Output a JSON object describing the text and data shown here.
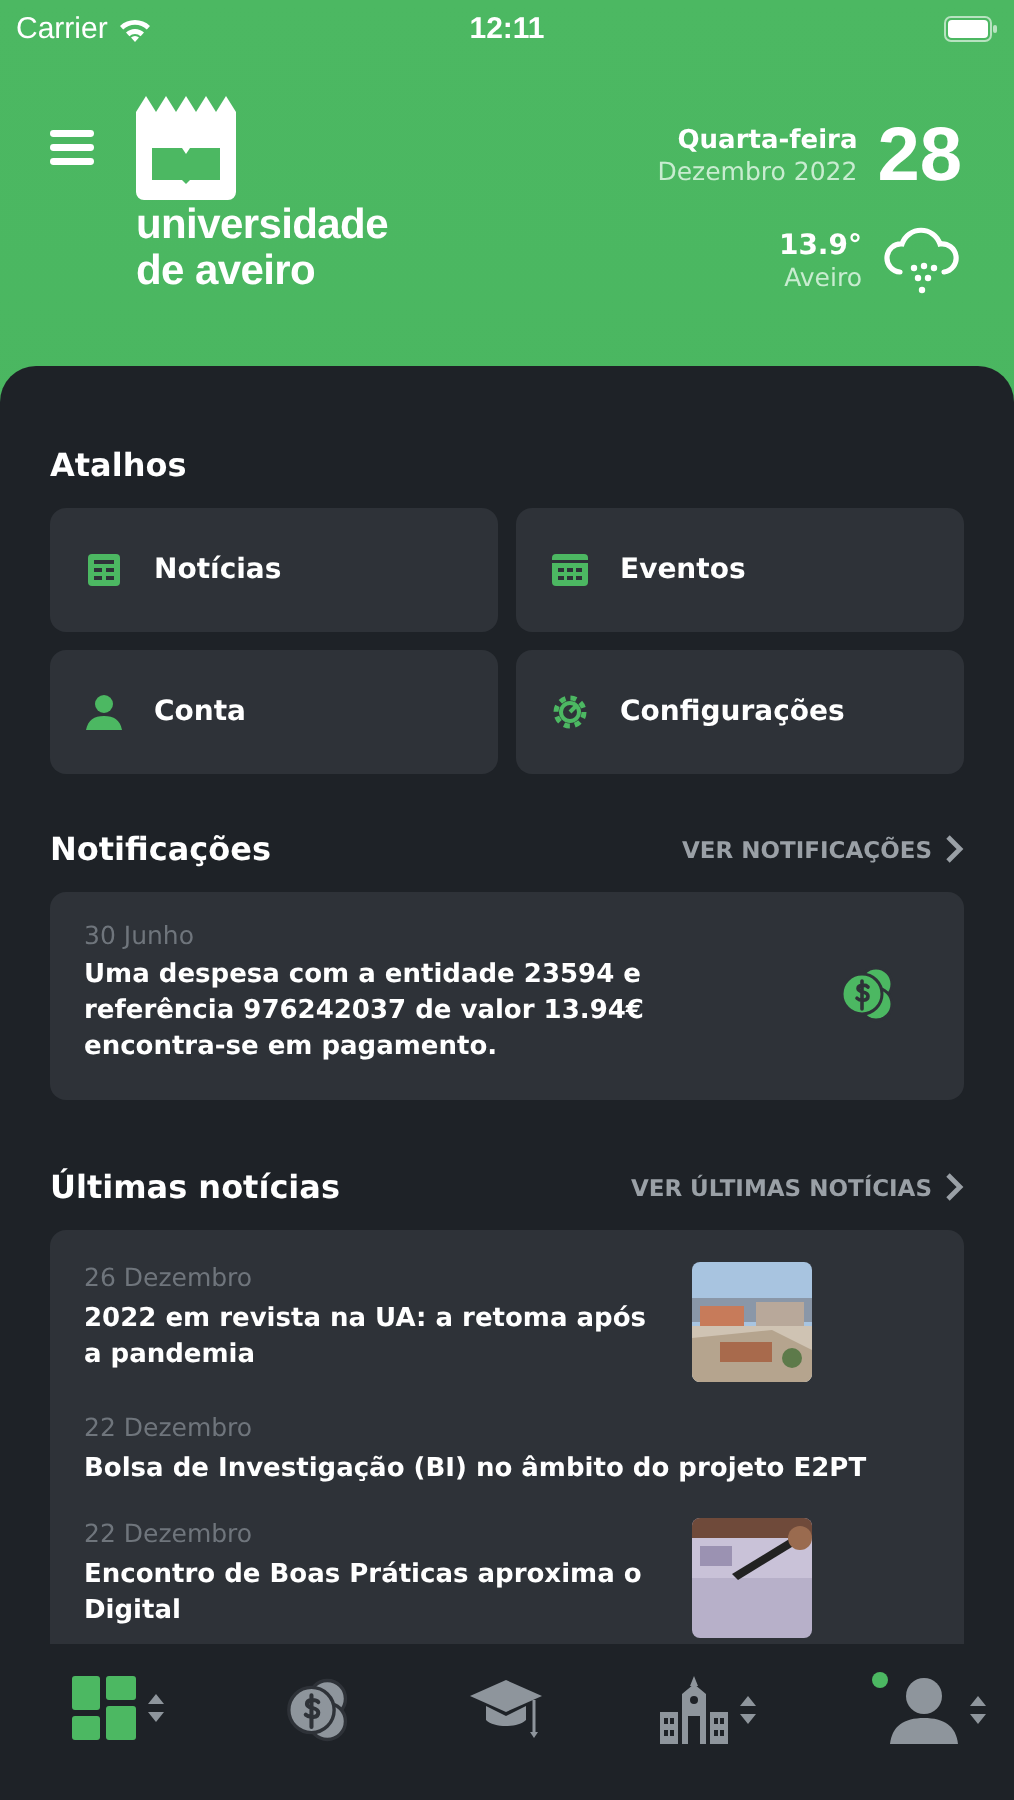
{
  "status_bar": {
    "carrier": "Carrier",
    "time": "12:11"
  },
  "header": {
    "logo_lines": [
      "universidade",
      "de aveiro"
    ],
    "weekday": "Quarta-feira",
    "month_year": "Dezembro 2022",
    "day": "28",
    "temperature": "13.9°",
    "city": "Aveiro"
  },
  "shortcuts": {
    "title": "Atalhos",
    "items": [
      {
        "label": "Notícias"
      },
      {
        "label": "Eventos"
      },
      {
        "label": "Conta"
      },
      {
        "label": "Configurações"
      }
    ]
  },
  "notifications": {
    "title": "Notificações",
    "link": "VER NOTIFICAÇÕES",
    "items": [
      {
        "date": "30 Junho",
        "text": "Uma despesa com a entidade 23594 e referência 976242037 de valor 13.94€ encontra-se em pagamento."
      }
    ]
  },
  "news": {
    "title": "Últimas notícias",
    "link": "VER ÚLTIMAS NOTÍCIAS",
    "items": [
      {
        "date": "26 Dezembro",
        "title": "2022 em revista na UA: a retoma após a pandemia",
        "kind": "picture"
      },
      {
        "date": "22 Dezembro",
        "title": "Bolsa de Investigação (BI) no âmbito do projeto E2PT",
        "kind": "plain"
      },
      {
        "date": "22 Dezembro",
        "title": "Encontro de Boas Práticas aproxima o Digital",
        "kind": "picture"
      }
    ]
  },
  "tab_bar": {
    "items": [
      {
        "selected": true,
        "menu": true,
        "badge": false
      },
      {
        "selected": false,
        "menu": false,
        "badge": false
      },
      {
        "selected": false,
        "menu": false,
        "badge": false
      },
      {
        "selected": false,
        "menu": true,
        "badge": false
      },
      {
        "selected": false,
        "menu": true,
        "badge": true
      }
    ]
  }
}
